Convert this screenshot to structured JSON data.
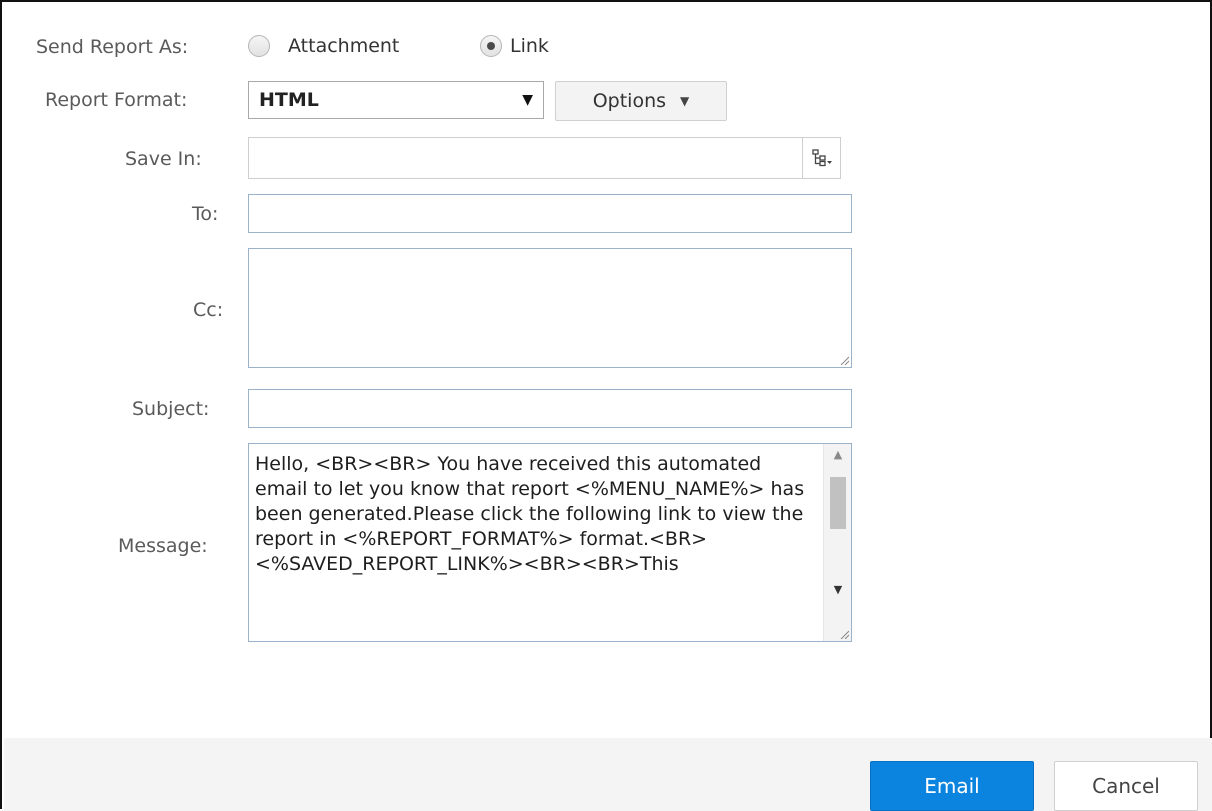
{
  "form": {
    "send_as": {
      "label": "Send Report As:",
      "options": [
        {
          "label": "Attachment",
          "checked": false
        },
        {
          "label": "Link",
          "checked": true
        }
      ]
    },
    "report_format": {
      "label": "Report Format:",
      "selected": "HTML",
      "arrow": "▼",
      "options_button": "Options",
      "options_caret": "▼"
    },
    "save_in": {
      "label": "Save In:",
      "value": "",
      "tree_icon": "folder-tree-icon"
    },
    "to": {
      "label": "To:",
      "value": ""
    },
    "cc": {
      "label": "Cc:",
      "value": ""
    },
    "subject": {
      "label": "Subject:",
      "value": ""
    },
    "message": {
      "label": "Message:",
      "value": "Hello, <BR><BR> You have received this automated email to let you know that report <%MENU_NAME%> has been generated.Please click the following link to view the report in <%REPORT_FORMAT%> format.<BR> <%SAVED_REPORT_LINK%><BR><BR>This"
    }
  },
  "footer": {
    "email_button": "Email",
    "cancel_button": "Cancel"
  },
  "colors": {
    "primary": "#0b84e0",
    "input_border": "#9bb3c8"
  }
}
